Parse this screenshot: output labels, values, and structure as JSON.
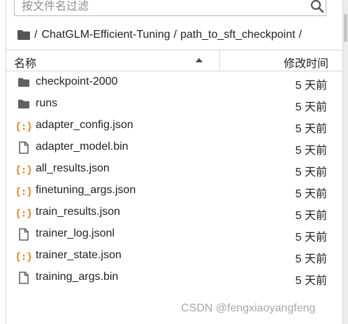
{
  "search": {
    "placeholder": "按文件名过滤",
    "value": ""
  },
  "breadcrumb": {
    "root": "/",
    "segments": [
      "ChatGLM-Efficient-Tuning",
      "path_to_sft_checkpoint"
    ],
    "separator": "/"
  },
  "header": {
    "name": "名称",
    "modified": "修改时间",
    "sort": "ascending"
  },
  "files": [
    {
      "name": "checkpoint-2000",
      "type": "folder",
      "modified": "5 天前"
    },
    {
      "name": "runs",
      "type": "folder",
      "modified": "5 天前"
    },
    {
      "name": "adapter_config.json",
      "type": "json",
      "modified": "5 天前"
    },
    {
      "name": "adapter_model.bin",
      "type": "file",
      "modified": "5 天前"
    },
    {
      "name": "all_results.json",
      "type": "json",
      "modified": "5 天前"
    },
    {
      "name": "finetuning_args.json",
      "type": "json",
      "modified": "5 天前"
    },
    {
      "name": "train_results.json",
      "type": "json",
      "modified": "5 天前"
    },
    {
      "name": "trainer_log.jsonl",
      "type": "file",
      "modified": "5 天前"
    },
    {
      "name": "trainer_state.json",
      "type": "json",
      "modified": "5 天前"
    },
    {
      "name": "training_args.bin",
      "type": "file",
      "modified": "5 天前"
    }
  ],
  "watermark": "CSDN @fengxiaoyangfeng",
  "colors": {
    "folder": "#616161",
    "json": "#f57c00",
    "file": "#616161",
    "text": "#222222"
  }
}
